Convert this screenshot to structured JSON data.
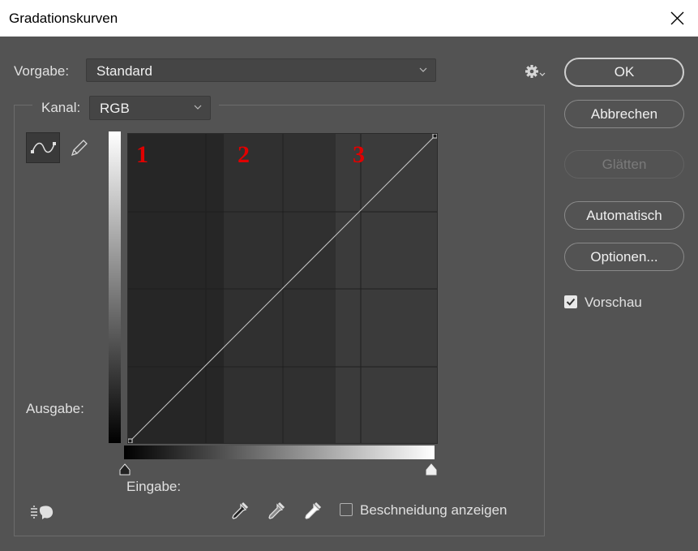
{
  "window": {
    "title": "Gradationskurven"
  },
  "preset": {
    "label": "Vorgabe:",
    "value": "Standard"
  },
  "channel": {
    "label": "Kanal:",
    "value": "RGB"
  },
  "buttons": {
    "ok": "OK",
    "cancel": "Abbrechen",
    "smooth": "Glätten",
    "auto": "Automatisch",
    "options": "Optionen..."
  },
  "preview": {
    "label": "Vorschau",
    "checked": true
  },
  "curve": {
    "output_label": "Ausgabe:",
    "input_label": "Eingabe:",
    "zone_numbers": [
      "1",
      "2",
      "3"
    ],
    "points": [
      [
        0,
        0
      ],
      [
        255,
        255
      ]
    ]
  },
  "clipping": {
    "label": "Beschneidung anzeigen",
    "checked": false
  },
  "colors": {
    "dialog_bg": "#535353",
    "curve_bg": "#3c3c3c",
    "zone_dark": "#262626",
    "zone_mid": "#303030",
    "zone_number": "#e00000"
  },
  "icons": {
    "close": "close-icon",
    "gear": "gear-icon",
    "curve_tool": "curve-edit-icon",
    "pencil_tool": "pencil-icon",
    "auto_targeting": "targeted-adjustment-icon",
    "black_point": "black-eyedropper-icon",
    "gray_point": "gray-eyedropper-icon",
    "white_point": "white-eyedropper-icon"
  }
}
